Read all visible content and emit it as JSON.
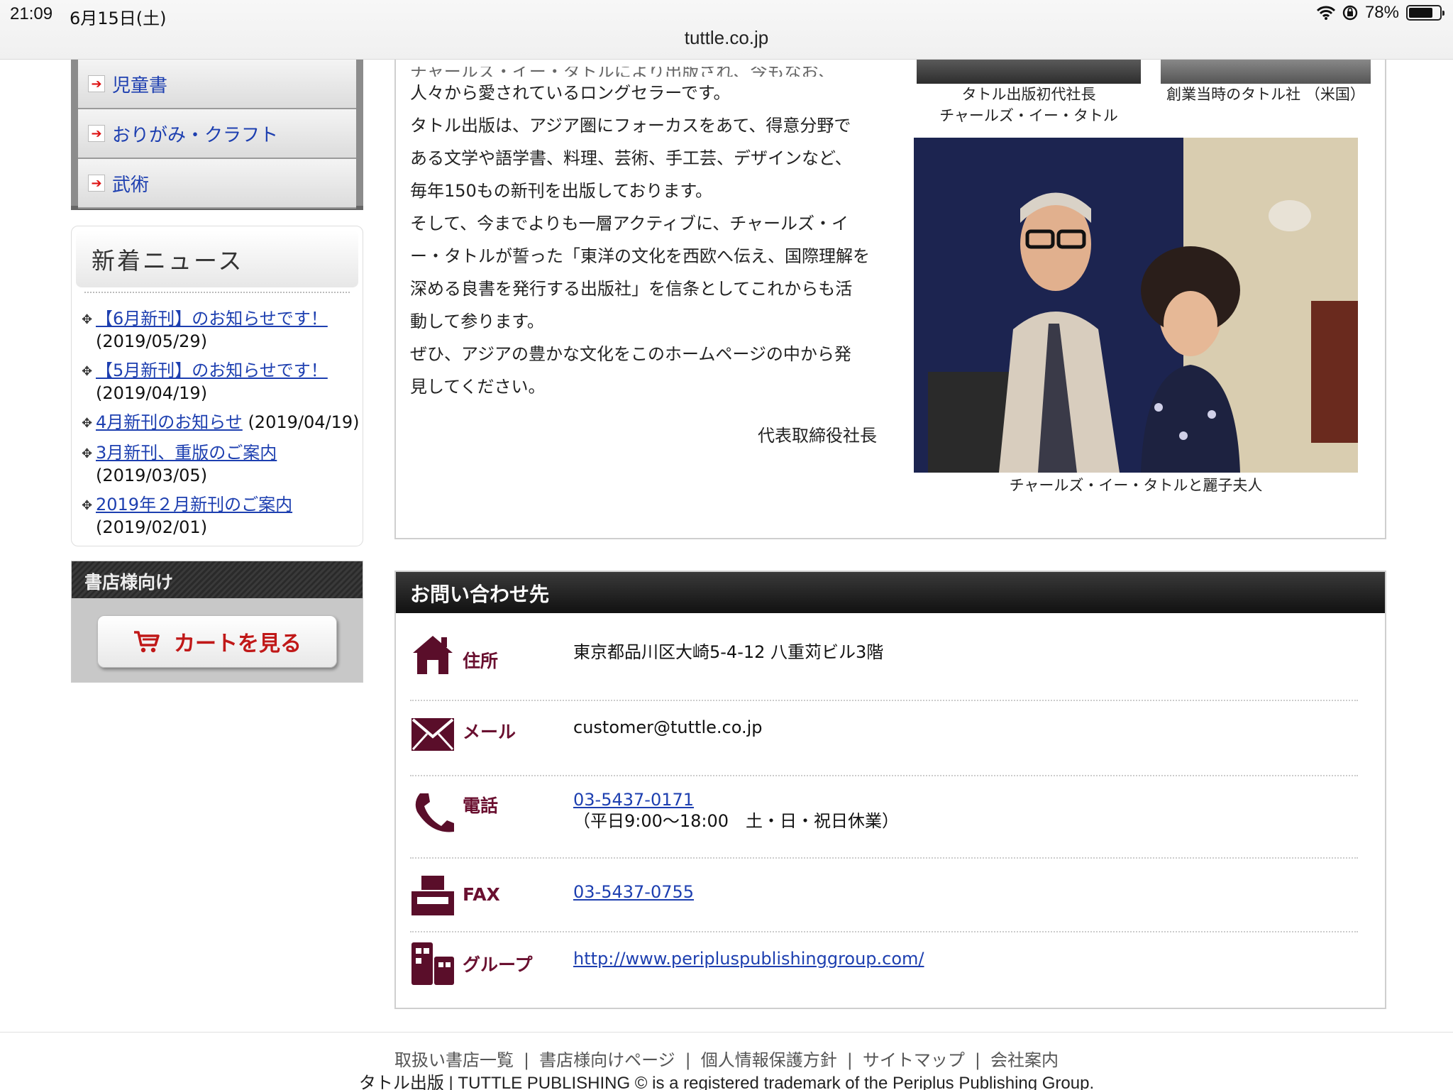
{
  "status_bar": {
    "time": "21:09",
    "date": "6月15日(土)",
    "battery_percent": "78%",
    "battery_level": 0.78,
    "url": "tuttle.co.jp"
  },
  "sidebar": {
    "menu_items": [
      {
        "label": "児童書"
      },
      {
        "label": "おりがみ・クラフト"
      },
      {
        "label": "武術"
      }
    ],
    "news": {
      "title": "新着ニュース",
      "items": [
        {
          "title": "【6月新刊】のお知らせです！",
          "date": "(2019/05/29)"
        },
        {
          "title": "【5月新刊】のお知らせです！",
          "date": "(2019/04/19)"
        },
        {
          "title": "4月新刊のお知らせ",
          "date": "(2019/04/19)"
        },
        {
          "title": "3月新刊、重版のご案内",
          "date": "(2019/03/05)"
        },
        {
          "title": "2019年２月新刊のご案内",
          "date": "(2019/02/01)"
        }
      ]
    },
    "shop": {
      "title": "書店様向け",
      "cart_button": "カートを見る"
    }
  },
  "main": {
    "cut_line": "チャールズ・イー・タトルにより出版され、今もなお、",
    "paragraph_lines": [
      "人々から愛されているロングセラーです。",
      "タトル出版は、アジア圏にフォーカスをあて、得意分野で",
      "ある文学や語学書、料理、芸術、手工芸、デザインなど、",
      "毎年150もの新刊を出版しております。",
      "そして、今までよりも一層アクティブに、チャールズ・イ",
      "ー・タトルが誓った「東洋の文化を西欧へ伝え、国際理解を",
      "深める良書を発行する出版社」を信条としてこれからも活",
      "動して参ります。",
      "ぜひ、アジアの豊かな文化をこのホームページの中から発",
      "見してください。"
    ],
    "signature": "代表取締役社長",
    "photo_caption_1_line1": "タトル出版初代社長",
    "photo_caption_1_line2": "チャールズ・イー・タトル",
    "photo_caption_2": "創業当時のタトル社 （米国）",
    "photo_caption_3": "チャールズ・イー・タトルと麗子夫人"
  },
  "contact": {
    "title": "お問い合わせ先",
    "rows": [
      {
        "label": "住所",
        "icon": "house-icon",
        "value": "東京都品川区大崎5-4-12 八重苅ビル3階"
      },
      {
        "label": "メール",
        "icon": "envelope-icon",
        "value": "customer@tuttle.co.jp"
      },
      {
        "label": "電話",
        "icon": "phone-icon",
        "value": "03-5437-0171",
        "note": "（平日9:00〜18:00　土・日・祝日休業）"
      },
      {
        "label": "FAX",
        "icon": "fax-icon",
        "value": "03-5437-0755"
      },
      {
        "label": "グループ",
        "icon": "buildings-icon",
        "value": "http://www.periplus​publishinggroup.com/"
      }
    ]
  },
  "footer": {
    "links": [
      "取扱い書店一覧",
      "書店様向けページ",
      "個人情報保護方針",
      "サイトマップ",
      "会社案内"
    ],
    "copyright": "タトル出版 | TUTTLE PUBLISHING © is a registered trademark of the Periplus Publishing Group."
  },
  "colors": {
    "accent": "#6a1030",
    "link": "#1d3fb0",
    "cart": "#c01818"
  }
}
